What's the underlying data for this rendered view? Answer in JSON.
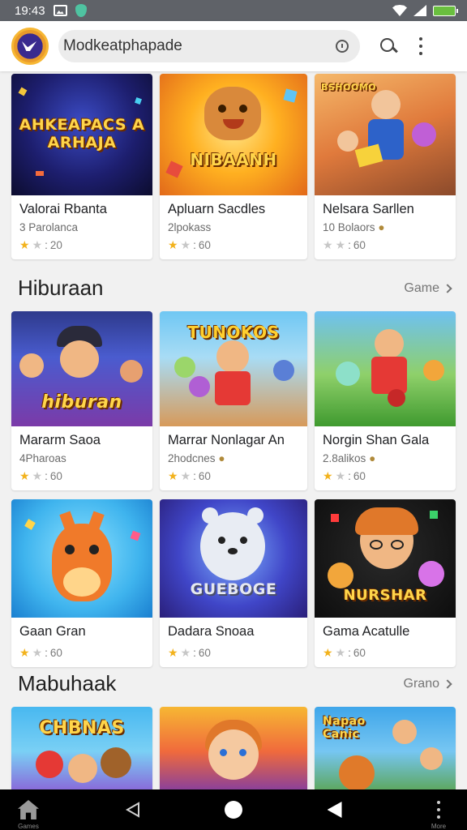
{
  "status_bar": {
    "time": "19:43"
  },
  "app_bar": {
    "search_text": "Modkeatphapade"
  },
  "sections": [
    {
      "title": "",
      "more": "",
      "cards": [
        {
          "thumb_text": "AHKEAPACS A ARHAJA",
          "title": "Valorai Rbanta",
          "sub": "3 Parolanca",
          "rating": "20"
        },
        {
          "thumb_text": "NIBAANH",
          "title": "Apluarn Sacdles",
          "sub": "2lpokass",
          "rating": "60"
        },
        {
          "thumb_text": "BSHOOMO",
          "title": "Nelsara Sarllen",
          "sub": "10 Bolaors",
          "rating": "60"
        }
      ]
    },
    {
      "title": "Hiburaan",
      "more": "Game",
      "cards": [
        {
          "thumb_text": "hiburan",
          "title": "Mararm Saoa",
          "sub": "4Pharoas",
          "rating": "60"
        },
        {
          "thumb_text": "TUNOKOS",
          "title": "Marrar Nonlagar An",
          "sub": "2hodcnes",
          "rating": "60"
        },
        {
          "thumb_text": "",
          "title": "Norgin Shan Gala",
          "sub": "2.8alikos",
          "rating": "60"
        },
        {
          "thumb_text": "",
          "title": "Gaan Gran",
          "sub": "",
          "rating": "60"
        },
        {
          "thumb_text": "GUEBOGE",
          "title": "Dadara Snoaa",
          "sub": "",
          "rating": "60"
        },
        {
          "thumb_text": "NURSHAR",
          "title": "Gama Acatulle",
          "sub": "",
          "rating": "60"
        }
      ]
    },
    {
      "title": "Mabuhaak",
      "more": "Grano",
      "cards": [
        {
          "thumb_text": "CHBNAS",
          "title": "",
          "sub": "",
          "rating": ""
        },
        {
          "thumb_text": "",
          "title": "",
          "sub": "",
          "rating": ""
        },
        {
          "thumb_text": "Napao Canic",
          "title": "",
          "sub": "",
          "rating": ""
        }
      ]
    }
  ],
  "nav_bar": {
    "home_label": "Games",
    "more_label": "More"
  },
  "colors": {
    "star": "#f2b21c",
    "status_bar": "#5f6268",
    "battery": "#6abf3f"
  },
  "icons": [
    "app-logo-icon",
    "clock-icon",
    "search-icon",
    "more-vert-icon",
    "home-icon",
    "back-icon",
    "home-circle-icon",
    "recent-icon"
  ]
}
